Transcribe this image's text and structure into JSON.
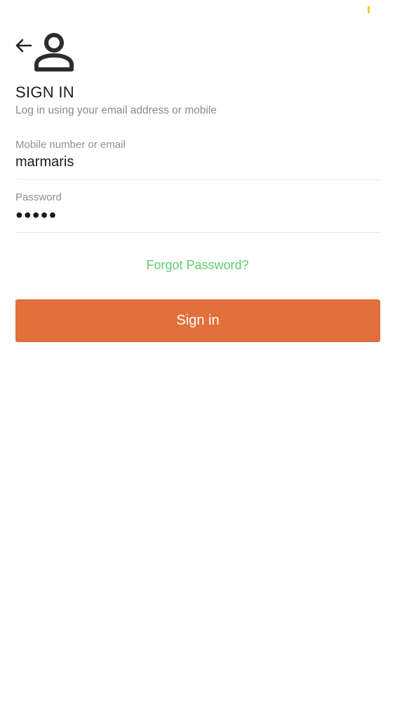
{
  "header": {
    "back_icon": "arrow-left-icon",
    "user_icon": "person-icon"
  },
  "page": {
    "title": "SIGN IN",
    "subtitle": "Log in using your email address or mobile"
  },
  "form": {
    "email": {
      "label": "Mobile number or email",
      "value": "marmaris"
    },
    "password": {
      "label": "Password",
      "value": "●●●●●"
    },
    "forgot_label": "Forgot Password?",
    "submit_label": "Sign in"
  },
  "colors": {
    "accent": "#e2703a",
    "link": "#5fcf6c",
    "status_indicator": "#f6c90e"
  }
}
